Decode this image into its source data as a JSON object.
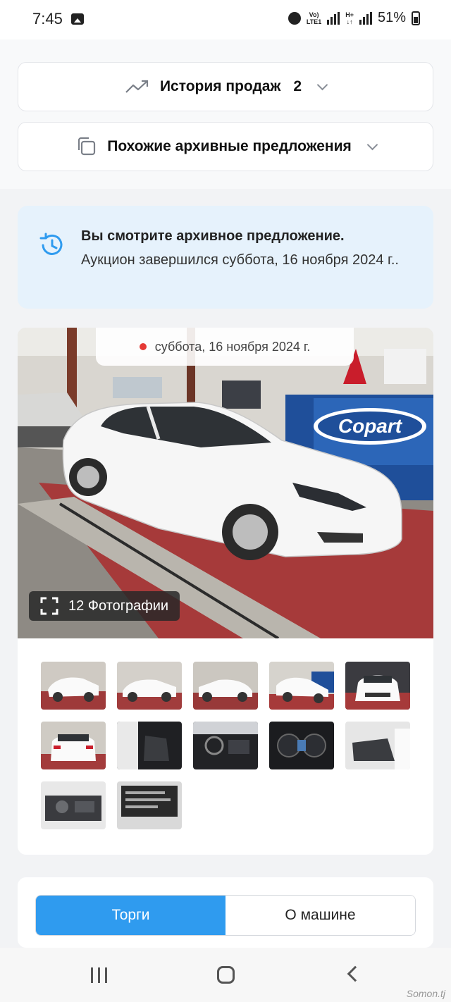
{
  "status_bar": {
    "time": "7:45",
    "battery": "51%",
    "icons": [
      "gallery-icon",
      "alarm-icon",
      "volte-icon",
      "signal-icon",
      "battery-icon"
    ]
  },
  "sales_history": {
    "label": "История продаж",
    "count": "2",
    "icon": "trending-up-icon"
  },
  "similar_offers": {
    "label": "Похожие архивные предложения",
    "icon": "copy-icon"
  },
  "archive_notice": {
    "title": "Вы смотрите архивное предложение.",
    "text": "Аукцион завершился суббота, 16 ноября 2024 г..",
    "icon": "history-icon",
    "accent": "#2f9bef"
  },
  "gallery": {
    "date": "суббота, 16 ноября 2024 г.",
    "photo_count_label": "12 Фотографии",
    "main_photo_sign": "Copart",
    "thumbnails": [
      {
        "kind": "front-left"
      },
      {
        "kind": "side-left"
      },
      {
        "kind": "side-right"
      },
      {
        "kind": "front-right"
      },
      {
        "kind": "front"
      },
      {
        "kind": "rear"
      },
      {
        "kind": "interior-front"
      },
      {
        "kind": "dashboard"
      },
      {
        "kind": "gauges"
      },
      {
        "kind": "interior-rear"
      },
      {
        "kind": "engine"
      },
      {
        "kind": "vin-label"
      }
    ]
  },
  "tabs": [
    {
      "label": "Торги",
      "active": true
    },
    {
      "label": "О машине",
      "active": false
    }
  ],
  "nav": {
    "icons": [
      "recents-icon",
      "home-icon",
      "back-icon"
    ]
  },
  "watermark": "Somon.tj"
}
